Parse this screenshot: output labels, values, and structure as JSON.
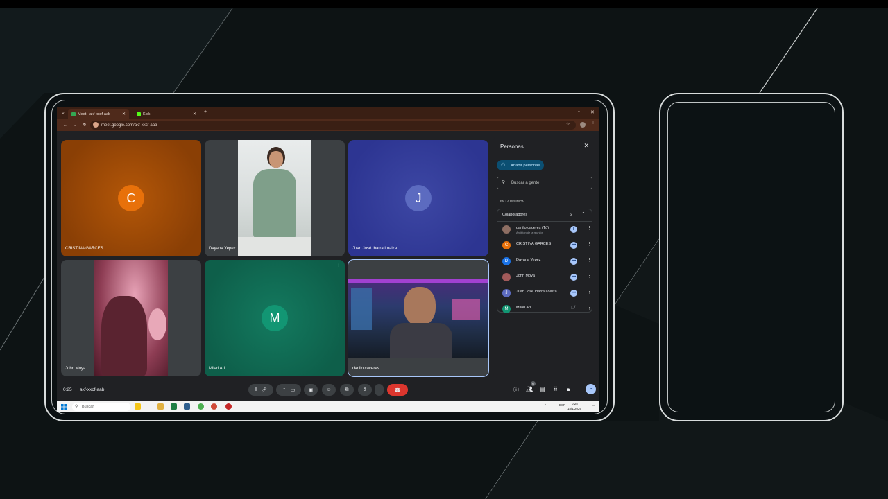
{
  "browser": {
    "tabs": [
      {
        "label": "Meet - akf-xxcf-aab",
        "active": true
      },
      {
        "label": "Kick",
        "active": false
      }
    ],
    "url": "meet.google.com/akf-xxcf-aab"
  },
  "tiles": [
    {
      "name": "CRISTINA GARCES",
      "initial": "C",
      "color": "#d15b07"
    },
    {
      "name": "Dayana Yepez",
      "initial": "",
      "color": "#3c4043"
    },
    {
      "name": "Juan José Ibarra Loaiza",
      "initial": "J",
      "color": "#5c6bc0"
    },
    {
      "name": "John Moya",
      "initial": "",
      "color": "#3c4043"
    },
    {
      "name": "Milari Ari",
      "initial": "M",
      "color": "#129673"
    },
    {
      "name": "danilo caceres",
      "initial": "",
      "color": "#3c4043"
    }
  ],
  "people_panel": {
    "title": "Personas",
    "add_button": "Añadir personas",
    "search_placeholder": "Buscar a gente",
    "section_label": "EN LA REUNIÓN",
    "group_label": "Colaboradores",
    "group_count": "6",
    "people": [
      {
        "name": "danilo caceres (Tú)",
        "sub": "Anfitrión de la reunión",
        "initial": "",
        "color": "#8d6e63",
        "status": "speaking"
      },
      {
        "name": "CRISTINA GARCES",
        "sub": "",
        "initial": "C",
        "color": "#e8710a",
        "status": "more"
      },
      {
        "name": "Dayana Yepez",
        "sub": "",
        "initial": "D",
        "color": "#1a73e8",
        "status": "more"
      },
      {
        "name": "John Moya",
        "sub": "",
        "initial": "",
        "color": "#a15a5a",
        "status": "more"
      },
      {
        "name": "Juan José Ibarra Loaiza",
        "sub": "",
        "initial": "J",
        "color": "#5c6bc0",
        "status": "more"
      },
      {
        "name": "Milari Ari",
        "sub": "",
        "initial": "M",
        "color": "#129673",
        "status": "muted"
      }
    ]
  },
  "controls": {
    "time": "0:25",
    "separator": "|",
    "meeting_code": "akf-xxcf-aab",
    "people_badge": "6"
  },
  "taskbar": {
    "search": "Buscar",
    "lang": "ESP",
    "clock": "0:25",
    "date": "18/1/2026"
  }
}
